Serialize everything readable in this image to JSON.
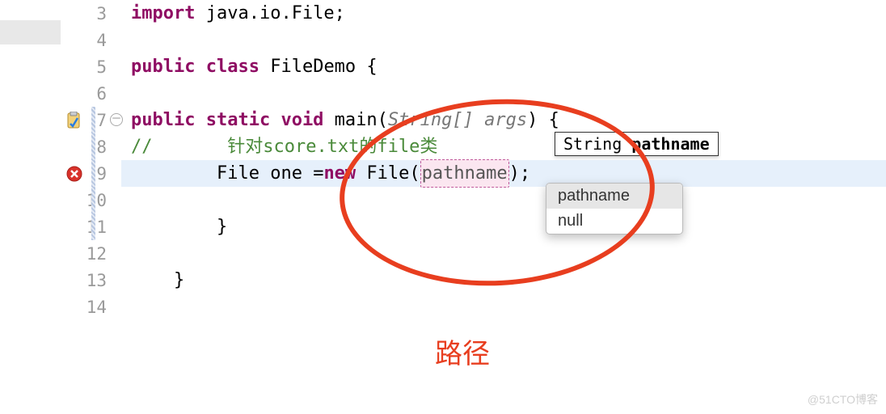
{
  "lines": {
    "3": {
      "kw": "import",
      "pkg": " java.io.File;"
    },
    "4": {
      "blank": ""
    },
    "5": {
      "kw1": "public",
      "kw2": " class",
      "name": " FileDemo ",
      "brace": "{"
    },
    "6": {
      "blank": ""
    },
    "7": {
      "kw1": "public",
      "kw2": " static",
      "kw3": " void",
      "name": " main",
      "args_open": "(",
      "argtype": "String[]",
      "argname": " args",
      "args_close": ") ",
      "brace": "{"
    },
    "8": {
      "slashes": "//",
      "comment": "       针对score.txt的file类"
    },
    "9": {
      "indent": "        ",
      "type": "File ",
      "var": "one ",
      "eq": "=",
      "kw": "new ",
      "call": "File(",
      "arg": "pathname",
      "close": ");"
    },
    "10": {
      "blank": ""
    },
    "11": {
      "brace": "        }"
    },
    "12": {
      "blank": ""
    },
    "13": {
      "brace": "    }"
    },
    "14": {
      "blank": ""
    }
  },
  "tooltip": {
    "type": "String ",
    "name": "pathname"
  },
  "popup": {
    "items": [
      "pathname",
      "null"
    ]
  },
  "annotation": {
    "label": "路径"
  },
  "watermark": "@51CTO博客"
}
